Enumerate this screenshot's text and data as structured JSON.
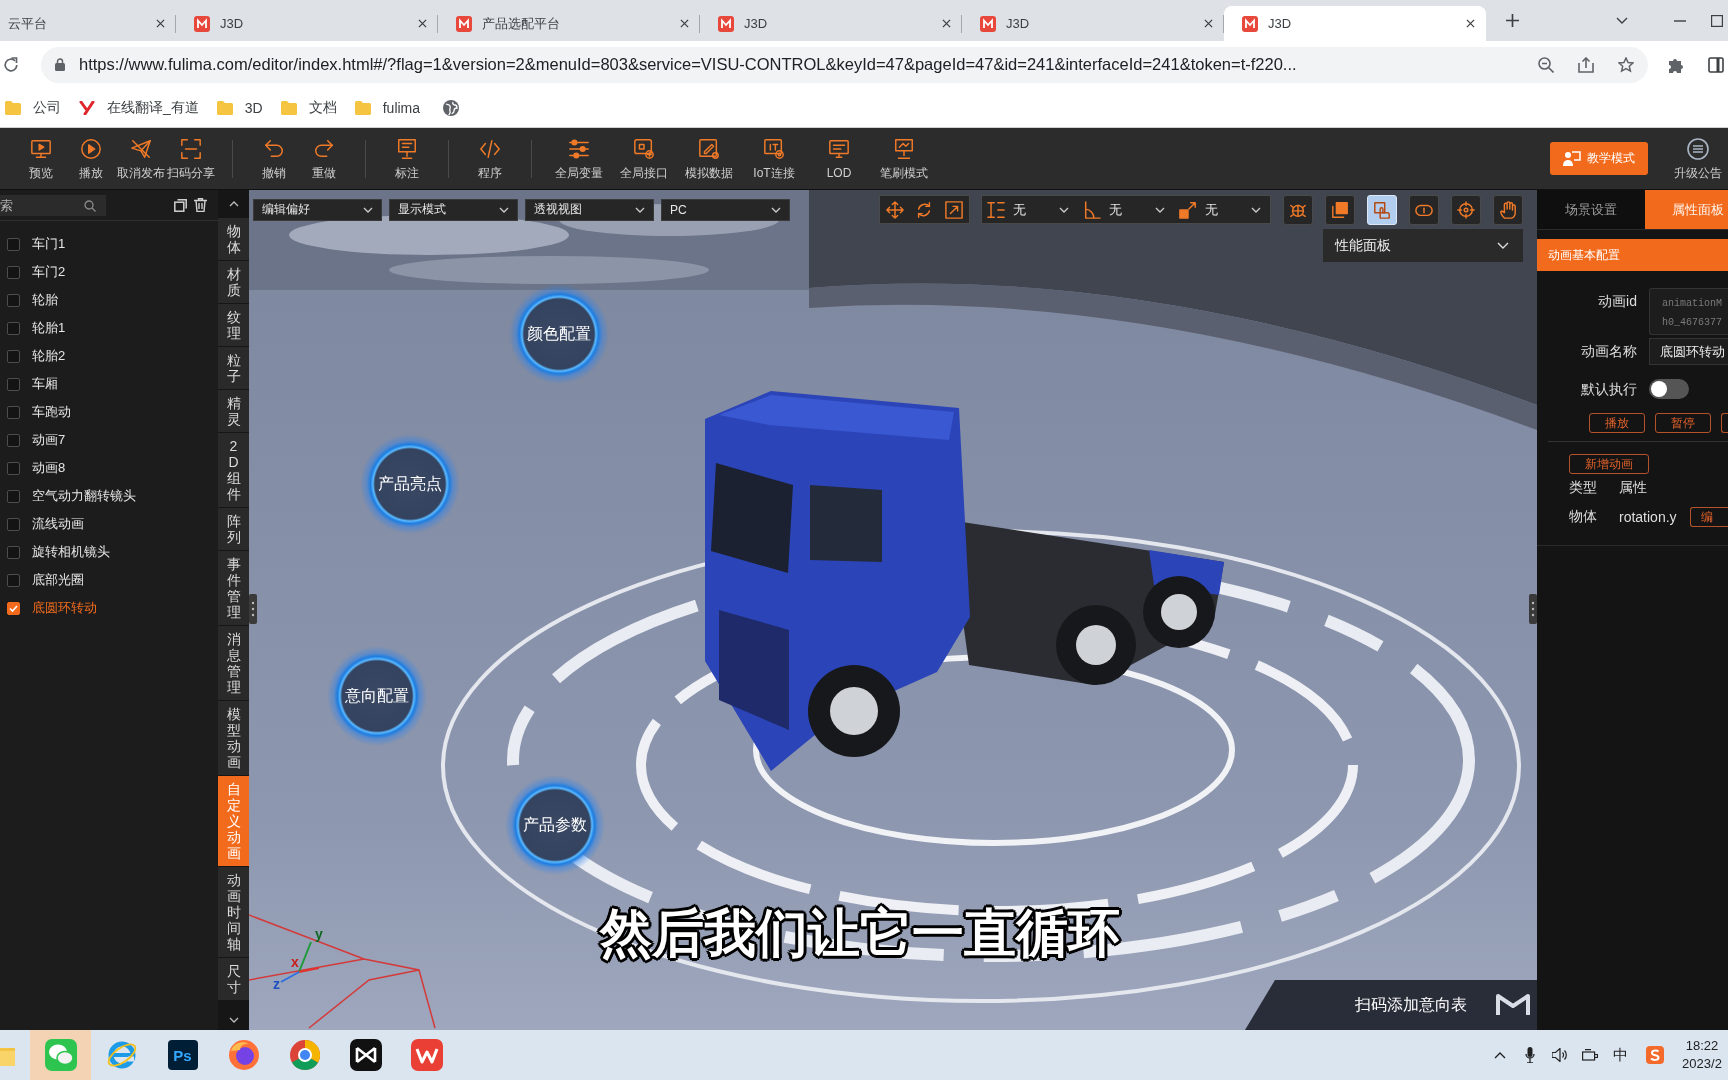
{
  "browser": {
    "tabs": [
      {
        "title": "云平台",
        "selected": false
      },
      {
        "title": "J3D",
        "selected": false
      },
      {
        "title": "产品选配平台",
        "selected": false
      },
      {
        "title": "J3D",
        "selected": false
      },
      {
        "title": "J3D",
        "selected": false
      },
      {
        "title": "J3D",
        "selected": true
      }
    ],
    "url": "https://www.fulima.com/editor/index.html#/?flag=1&version=2&menuId=803&service=VISU-CONTROL&keyId=47&pageId=47&id=241&interfaceId=241&token=t-f220...",
    "bookmarks": [
      {
        "label": "公司",
        "kind": "folder"
      },
      {
        "label": "在线翻译_有道",
        "kind": "site"
      },
      {
        "label": "3D",
        "kind": "folder"
      },
      {
        "label": "文档",
        "kind": "folder"
      },
      {
        "label": "fulima",
        "kind": "folder"
      }
    ]
  },
  "toolbar": {
    "groups": [
      {
        "items": [
          {
            "label": "预览"
          },
          {
            "label": "播放"
          },
          {
            "label": "取消发布"
          },
          {
            "label": "扫码分享"
          }
        ]
      },
      {
        "items": [
          {
            "label": "撤销"
          },
          {
            "label": "重做"
          }
        ]
      },
      {
        "items": [
          {
            "label": "标注"
          }
        ]
      },
      {
        "items": [
          {
            "label": "程序"
          }
        ]
      },
      {
        "items": [
          {
            "label": "全局变量"
          },
          {
            "label": "全局接口"
          },
          {
            "label": "模拟数据"
          },
          {
            "label": "IoT连接"
          },
          {
            "label": "LOD"
          },
          {
            "label": "笔刷模式"
          }
        ]
      }
    ],
    "teach_button": "教学模式",
    "announce": "升级公告"
  },
  "layer_panel": {
    "search": {
      "placeholder": "索"
    },
    "items": [
      {
        "label": "车门1",
        "checked": false
      },
      {
        "label": "车门2",
        "checked": false
      },
      {
        "label": "轮胎",
        "checked": false
      },
      {
        "label": "轮胎1",
        "checked": false
      },
      {
        "label": "轮胎2",
        "checked": false
      },
      {
        "label": "车厢",
        "checked": false
      },
      {
        "label": "车跑动",
        "checked": false
      },
      {
        "label": "动画7",
        "checked": false
      },
      {
        "label": "动画8",
        "checked": false
      },
      {
        "label": "空气动力翻转镜头",
        "checked": false
      },
      {
        "label": "流线动画",
        "checked": false
      },
      {
        "label": "旋转相机镜头",
        "checked": false
      },
      {
        "label": "底部光圈",
        "checked": false
      },
      {
        "label": "底圆环转动",
        "checked": true
      }
    ]
  },
  "side_tabs": [
    {
      "label": "物体",
      "selected": false
    },
    {
      "label": "材质",
      "selected": false
    },
    {
      "label": "纹理",
      "selected": false
    },
    {
      "label": "粒子",
      "selected": false
    },
    {
      "label": "精灵",
      "selected": false
    },
    {
      "label": "2D组件",
      "selected": false
    },
    {
      "label": "阵列",
      "selected": false
    },
    {
      "label": "事件管理",
      "selected": false
    },
    {
      "label": "消息管理",
      "selected": false
    },
    {
      "label": "模型动画",
      "selected": false
    },
    {
      "label": "自定义动画",
      "selected": true
    },
    {
      "label": "动画时间轴",
      "selected": false
    },
    {
      "label": "尺寸",
      "selected": false
    }
  ],
  "viewport": {
    "selects": [
      "编辑偏好",
      "显示模式",
      "透视视图",
      "PC"
    ],
    "constraints": [
      {
        "value": "无"
      },
      {
        "value": "无"
      },
      {
        "value": "无"
      }
    ],
    "view_tools": [
      {
        "selected": false
      },
      {
        "selected": false
      },
      {
        "selected": true
      },
      {
        "selected": false
      },
      {
        "selected": false
      },
      {
        "selected": false
      }
    ],
    "perf_panel": "性能面板",
    "hotspots": [
      "颜色配置",
      "产品亮点",
      "意向配置",
      "产品参数"
    ],
    "subtitle": "然后我们让它一直循环",
    "axes": [
      "y",
      "x",
      "z"
    ],
    "banner": "扫码添加意向表"
  },
  "property_panel": {
    "tabs": [
      {
        "label": "场景设置",
        "selected": false
      },
      {
        "label": "属性面板",
        "selected": true
      }
    ],
    "section": "动画基本配置",
    "id_field": {
      "label": "动画id",
      "value_lines": [
        "animationM",
        "h0_4676377"
      ]
    },
    "name_field": {
      "label": "动画名称",
      "value": "底圆环转动"
    },
    "auto_run": {
      "label": "默认执行",
      "on": false
    },
    "buttons": [
      "播放",
      "暂停"
    ],
    "add_button": "新增动画",
    "columns": [
      "类型",
      "属性"
    ],
    "rows": [
      {
        "cells": [
          "物体",
          "rotation.y"
        ],
        "action": "编"
      }
    ]
  },
  "taskbar": {
    "apps": [
      {
        "kind": "folder",
        "highlighted": false
      },
      {
        "kind": "chat",
        "highlighted": true
      },
      {
        "kind": "e-browser",
        "highlighted": false
      },
      {
        "kind": "ps",
        "highlighted": false,
        "glyph": "Ps"
      },
      {
        "kind": "fox-browser",
        "highlighted": false
      },
      {
        "kind": "ring-browser",
        "highlighted": false
      },
      {
        "kind": "editor",
        "highlighted": false
      },
      {
        "kind": "office",
        "highlighted": false
      }
    ],
    "ime": "中",
    "time": "18:22",
    "date": "2023/2"
  }
}
